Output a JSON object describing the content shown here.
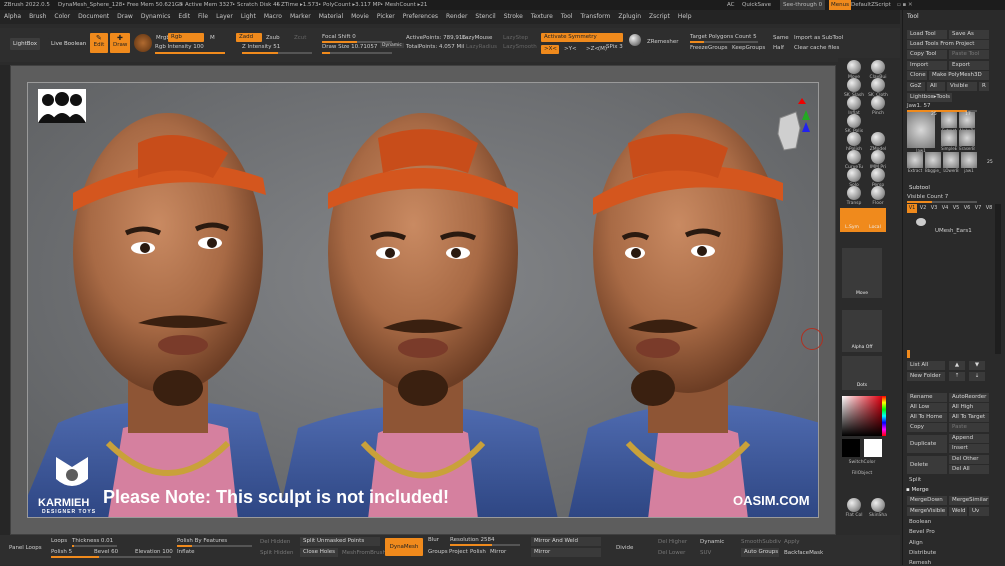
{
  "title": {
    "app": "ZBrush 2022.0.5",
    "doc": "DynaMesh_Sphere_128",
    "free_mem": "• Free Mem 50.621GB",
    "active_mem": "• Active Mem 3327",
    "scratch": "• Scratch Disk 45",
    "ztime": "• ZTime ▸1.573",
    "poly": "• PolyCount ▸3.117 MP",
    "mesh": "• MeshCount ▸21",
    "ac": "AC",
    "quicksave": "QuickSave",
    "seethrough": "See-through",
    "seethrough_val": "0",
    "menus": "Menus",
    "zscript": "DefaultZScript"
  },
  "menu": [
    "Alpha",
    "Brush",
    "Color",
    "Document",
    "Draw",
    "Dynamics",
    "Edit",
    "File",
    "Layer",
    "Light",
    "Macro",
    "Marker",
    "Material",
    "Movie",
    "Picker",
    "Preferences",
    "Render",
    "Stencil",
    "Stroke",
    "Texture",
    "Tool",
    "Transform",
    "Zplugin",
    "Zscript",
    "Help"
  ],
  "shelf": {
    "lightbox": "LightBox",
    "live_boolean": "Live Boolean",
    "edit": "Edit",
    "draw": "Draw",
    "mrgb": "Mrgb",
    "rgb": "Rgb",
    "m": "M",
    "rgb_intensity": "Rgb Intensity 100",
    "zadd": "Zadd",
    "zsub": "Zsub",
    "zcut": "Zcut",
    "z_intensity": "Z Intensity 51",
    "focal_shift": "Focal Shift 0",
    "draw_size": "Draw Size 10.71057",
    "dynamic": "Dynamic",
    "active_points": "ActivePoints: 789,916",
    "total_points": "TotalPoints: 4.057 Mil",
    "lazymouse": "LazyMouse",
    "lazyradius": "LazyRadius",
    "lazystep": "LazyStep",
    "lazysmooth": "LazySmooth",
    "activate_symmetry": "Activate Symmetry",
    "x": ">X<",
    "y": ">Y<",
    "z": ">Z<",
    "m_sym": "(M)",
    "spix": "SPix 3",
    "zremesher": "ZRemesher",
    "target_poly": "Target Polygons Count 5",
    "freeze_groups": "FreezeGroups",
    "keep_groups": "KeepGroups",
    "same": "Same",
    "half": "Half",
    "import_subtool": "Import as SubTool",
    "clear_cache": "Clear cache files"
  },
  "right_shelf": [
    "Move",
    "ClayBui",
    "SK_Slash",
    "SK_Cloth",
    "Inflat",
    "Pinch",
    "SK_Polis",
    "hPolish",
    "ZModel",
    "CurveTu",
    "IMM Pri",
    "Solo",
    "Persp",
    "Transp",
    "Floor",
    "Move",
    "Alpha Off",
    "Dots",
    "SwitchColor",
    "FillObject",
    "Flat Col",
    "SkinSha"
  ],
  "right_shelf_flags": {
    "floor": "Floor",
    "lsym": "L.Sym",
    "local": "Local",
    "xyz": "XYZ"
  },
  "tray": {
    "header": "Tool",
    "load_tool": "Load Tool",
    "save_as": "Save As",
    "load_tools_project": "Load Tools From Project",
    "copy_tool": "Copy Tool",
    "paste_tool": "Paste Tool",
    "import": "Import",
    "export": "Export",
    "clone": "Clone",
    "make_polymesh": "Make PolyMesh3D",
    "goz": "GoZ",
    "all": "All",
    "visible": "Visible",
    "r": "R",
    "lightbox_tools": "Lightbox▸Tools",
    "jaw": "Jaw1. 57",
    "thumb_labels": [
      "Jaw1",
      "Extract",
      "AlphaBr",
      "SimpleE",
      "EraserB",
      "Extract",
      "Bbggie_l",
      "LOwerB",
      "jaw1"
    ],
    "thumb_counts": [
      "25",
      "17",
      "25"
    ],
    "subtool": "Subtool",
    "visible_count": "Visible Count 7",
    "v_list": [
      "V1",
      "V2",
      "V3",
      "V4",
      "V5",
      "V6",
      "V7",
      "V8"
    ],
    "umesh": "UMesh_Ears1",
    "list_all": "List All",
    "new_folder": "New Folder",
    "rename": "Rename",
    "autoreorder": "AutoReorder",
    "all_low": "All Low",
    "all_high": "All High",
    "all_to_home": "All To Home",
    "all_to_target": "All To Target",
    "copy": "Copy",
    "paste": "Paste",
    "duplicate": "Duplicate",
    "append": "Append",
    "insert": "Insert",
    "delete": "Delete",
    "del_other": "Del Other",
    "del_all": "Del All",
    "split": "Split",
    "merge": "Merge",
    "merge_down": "MergeDown",
    "merge_similar": "MergeSimilar",
    "merge_visible": "MergeVisible",
    "weld": "Weld",
    "uv": "Uv",
    "boolean": "Boolean",
    "bevel_pro": "Bevel Pro",
    "align": "Align",
    "distribute": "Distribute",
    "remesh": "Remesh"
  },
  "bottom": {
    "panel_loops": "Panel Loops",
    "loops": "Loops",
    "thickness": "Thickness 0.01",
    "polish": "Polish 5",
    "bevel": "Bevel 60",
    "elevation": "Elevation 100",
    "polish_by_features": "Polish By Features",
    "inflate": "Inflate",
    "del_hidden": "Del Hidden",
    "split_hidden": "Split Hidden",
    "split_unmasked": "Split Unmasked Points",
    "close_holes": "Close Holes",
    "meshextract": "MeshFromBrush",
    "dynamesh": "DynaMesh",
    "blur": "Blur",
    "groups": "Groups",
    "project": "Project",
    "polish2": "Polish",
    "resolution": "Resolution 2584",
    "mirror_weld": "Mirror And Weld",
    "mirror": "Mirror",
    "divide": "Divide",
    "del_higher": "Del Higher",
    "del_lower": "Del Lower",
    "dynamic": "Dynamic",
    "smooth_subdiv": "SmoothSubdiv",
    "suv": "SUV",
    "apply": "Apply",
    "auto_groups": "Auto Groups",
    "backface_mask": "BackfaceMask"
  },
  "overlay": {
    "brand": "KARMIEH",
    "brand_sub": "DESIGNER TOYS",
    "note": "Please Note: This sculpt is not included!",
    "site": "OASIM.COM"
  },
  "colors": {
    "accent": "#f08a1c",
    "bg": "#2b2b2b",
    "canvas": "#6e7073"
  }
}
